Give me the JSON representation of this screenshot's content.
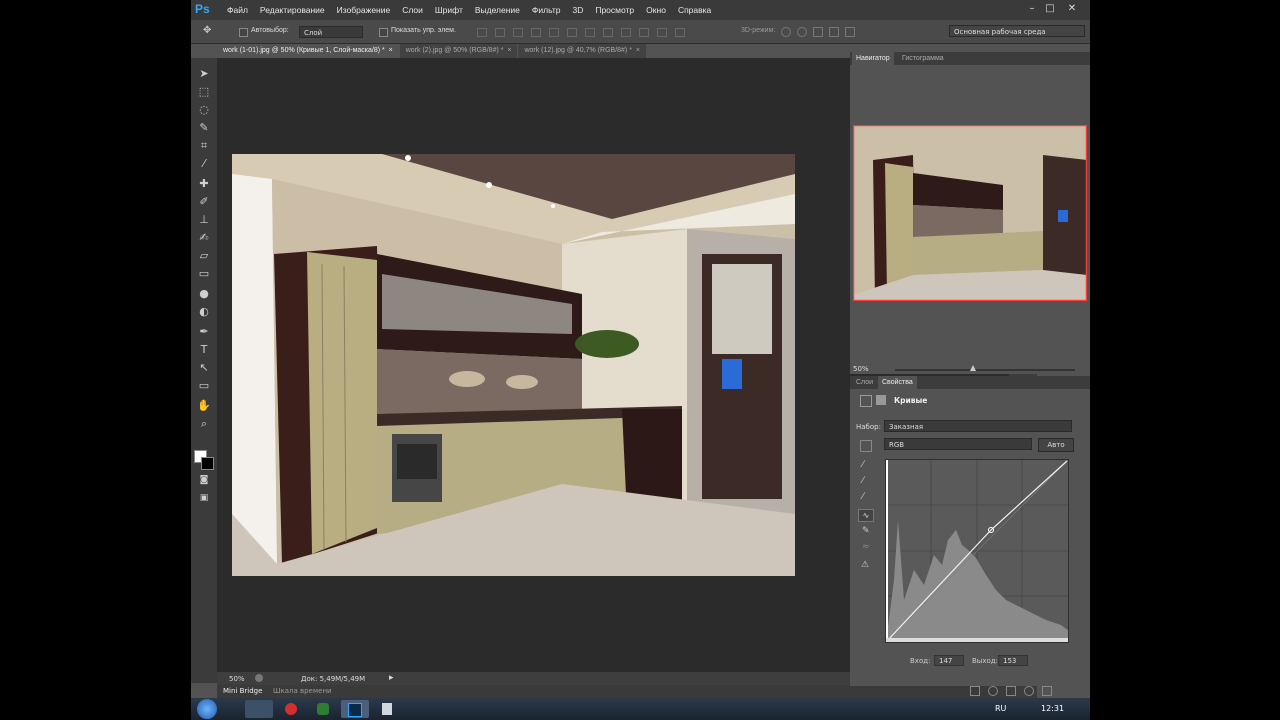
{
  "app": {
    "logo": "Ps",
    "menu": [
      "Файл",
      "Редактирование",
      "Изображение",
      "Слои",
      "Шрифт",
      "Выделение",
      "Фильтр",
      "3D",
      "Просмотр",
      "Окно",
      "Справка"
    ],
    "window_controls": [
      "–",
      "□",
      "✕"
    ]
  },
  "options": {
    "autoselect_label": "Автовыбор:",
    "autoselect_value": "Слой",
    "show_controls_label": "Показать упр. элем.",
    "mode3d_label": "3D-режим:",
    "workspace": "Основная рабочая среда"
  },
  "document_tabs": [
    {
      "label": "work (1-01).jpg @ 50% (Кривые 1, Слой-маска/8) *",
      "close": "×"
    },
    {
      "label": "work (2).jpg @ 50% (RGB/8#) *",
      "close": "×"
    },
    {
      "label": "work (12).jpg @ 40,7% (RGB/8#) *",
      "close": "×"
    }
  ],
  "status": {
    "zoom": "50%",
    "doc": "Док: 5,49M/5,49M"
  },
  "bottom_tabs": [
    "Mini Bridge",
    "Шкала времени"
  ],
  "navigator": {
    "tabs": [
      "Навигатор",
      "Гистограмма"
    ],
    "zoom": "50%"
  },
  "properties": {
    "tabs": [
      "Слои",
      "Свойства"
    ],
    "title": "Кривые",
    "preset_label": "Набор:",
    "preset_value": "Заказная",
    "channel": "RGB",
    "auto_button": "Авто",
    "input_label": "Вход:",
    "input_value": "147",
    "output_label": "Выход:",
    "output_value": "153"
  },
  "taskbar": {
    "lang": "RU",
    "time": "12:31"
  },
  "colors": {
    "accent": "#31a8ff",
    "panel": "#535353",
    "dark": "#2b2b2b"
  }
}
